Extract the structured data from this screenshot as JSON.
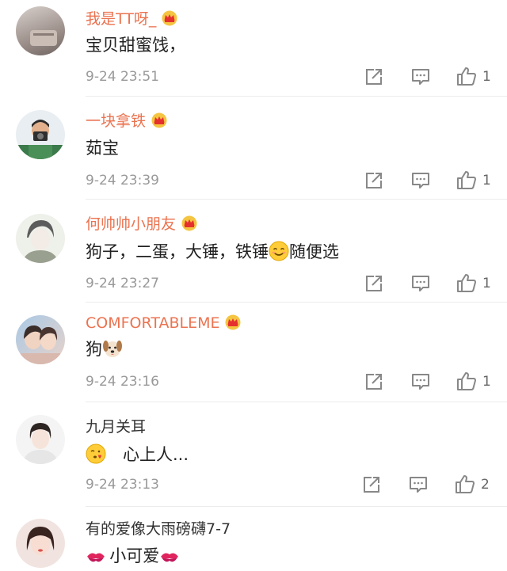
{
  "comments": [
    {
      "user": "我是TT呀_",
      "vip": true,
      "text": "宝贝甜蜜饯，",
      "time": "9-24 23:51",
      "likes": "1"
    },
    {
      "user": "一块拿铁",
      "vip": true,
      "text": "茹宝",
      "time": "9-24 23:39",
      "likes": "1"
    },
    {
      "user": "何帅帅小朋友",
      "vip": true,
      "text_before": "狗子，二蛋，大锤，铁锤",
      "emoji": "smiling-face-emoji",
      "text_after": "随便选",
      "time": "9-24 23:27",
      "likes": "1"
    },
    {
      "user": "COMFORTABLEME",
      "vip": true,
      "text_before": "狗",
      "emoji": "dog-face-emoji",
      "time": "9-24 23:16",
      "likes": "1"
    },
    {
      "user": "九月关耳",
      "vip": false,
      "emoji": "face-blowing-kiss-emoji",
      "text_after": "心上人...",
      "time": "9-24 23:13",
      "likes": "2"
    },
    {
      "user": "有的爱像大雨磅礴7-7",
      "vip": false,
      "emoji": "kiss-mark-emoji",
      "text_after": "小可爱",
      "emoji_end": "kiss-mark-emoji"
    }
  ],
  "colors": {
    "vip_name": "#eb7350",
    "icon": "#888888",
    "divider": "#ececec"
  },
  "icons": {
    "share": "share-icon",
    "comment": "comment-icon",
    "like": "thumbs-up-icon",
    "vip": "crown-badge-icon"
  }
}
